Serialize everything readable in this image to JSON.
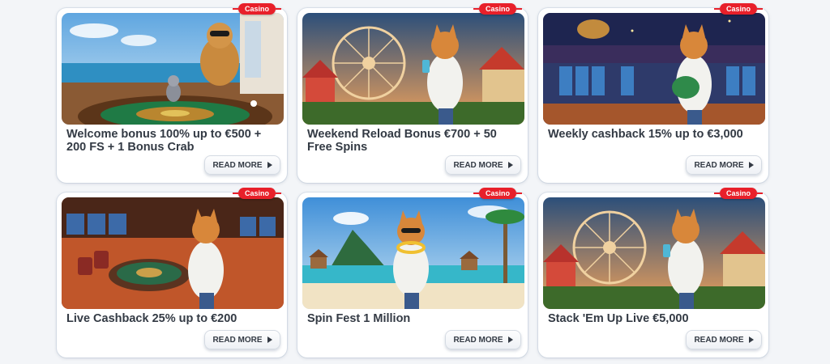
{
  "cards": [
    {
      "badge": "Casino",
      "title": "Welcome bonus 100% up to €500 + 200 FS + 1 Bonus Crab",
      "button": "READ MORE",
      "image": "cat-and-mouse-roulette-on-yacht"
    },
    {
      "badge": "Casino",
      "title": "Weekend Reload Bonus €700 + 50 Free Spins",
      "button": "READ MORE",
      "image": "cat-with-drink-at-fair-ferris-wheel"
    },
    {
      "badge": "Casino",
      "title": "Weekly cashback 15% up to €3,000",
      "button": "READ MORE",
      "image": "cat-with-money-bag-in-casino-hall"
    },
    {
      "badge": "Casino",
      "title": "Live Cashback 25% up to €200",
      "button": "READ MORE",
      "image": "cat-at-casino-roulette-table"
    },
    {
      "badge": "Casino",
      "title": "Spin Fest 1 Million",
      "button": "READ MORE",
      "image": "cat-on-tropical-beach-with-lei"
    },
    {
      "badge": "Casino",
      "title": "Stack 'Em Up Live €5,000",
      "button": "READ MORE",
      "image": "cat-with-drink-at-fair-ferris-wheel"
    }
  ]
}
